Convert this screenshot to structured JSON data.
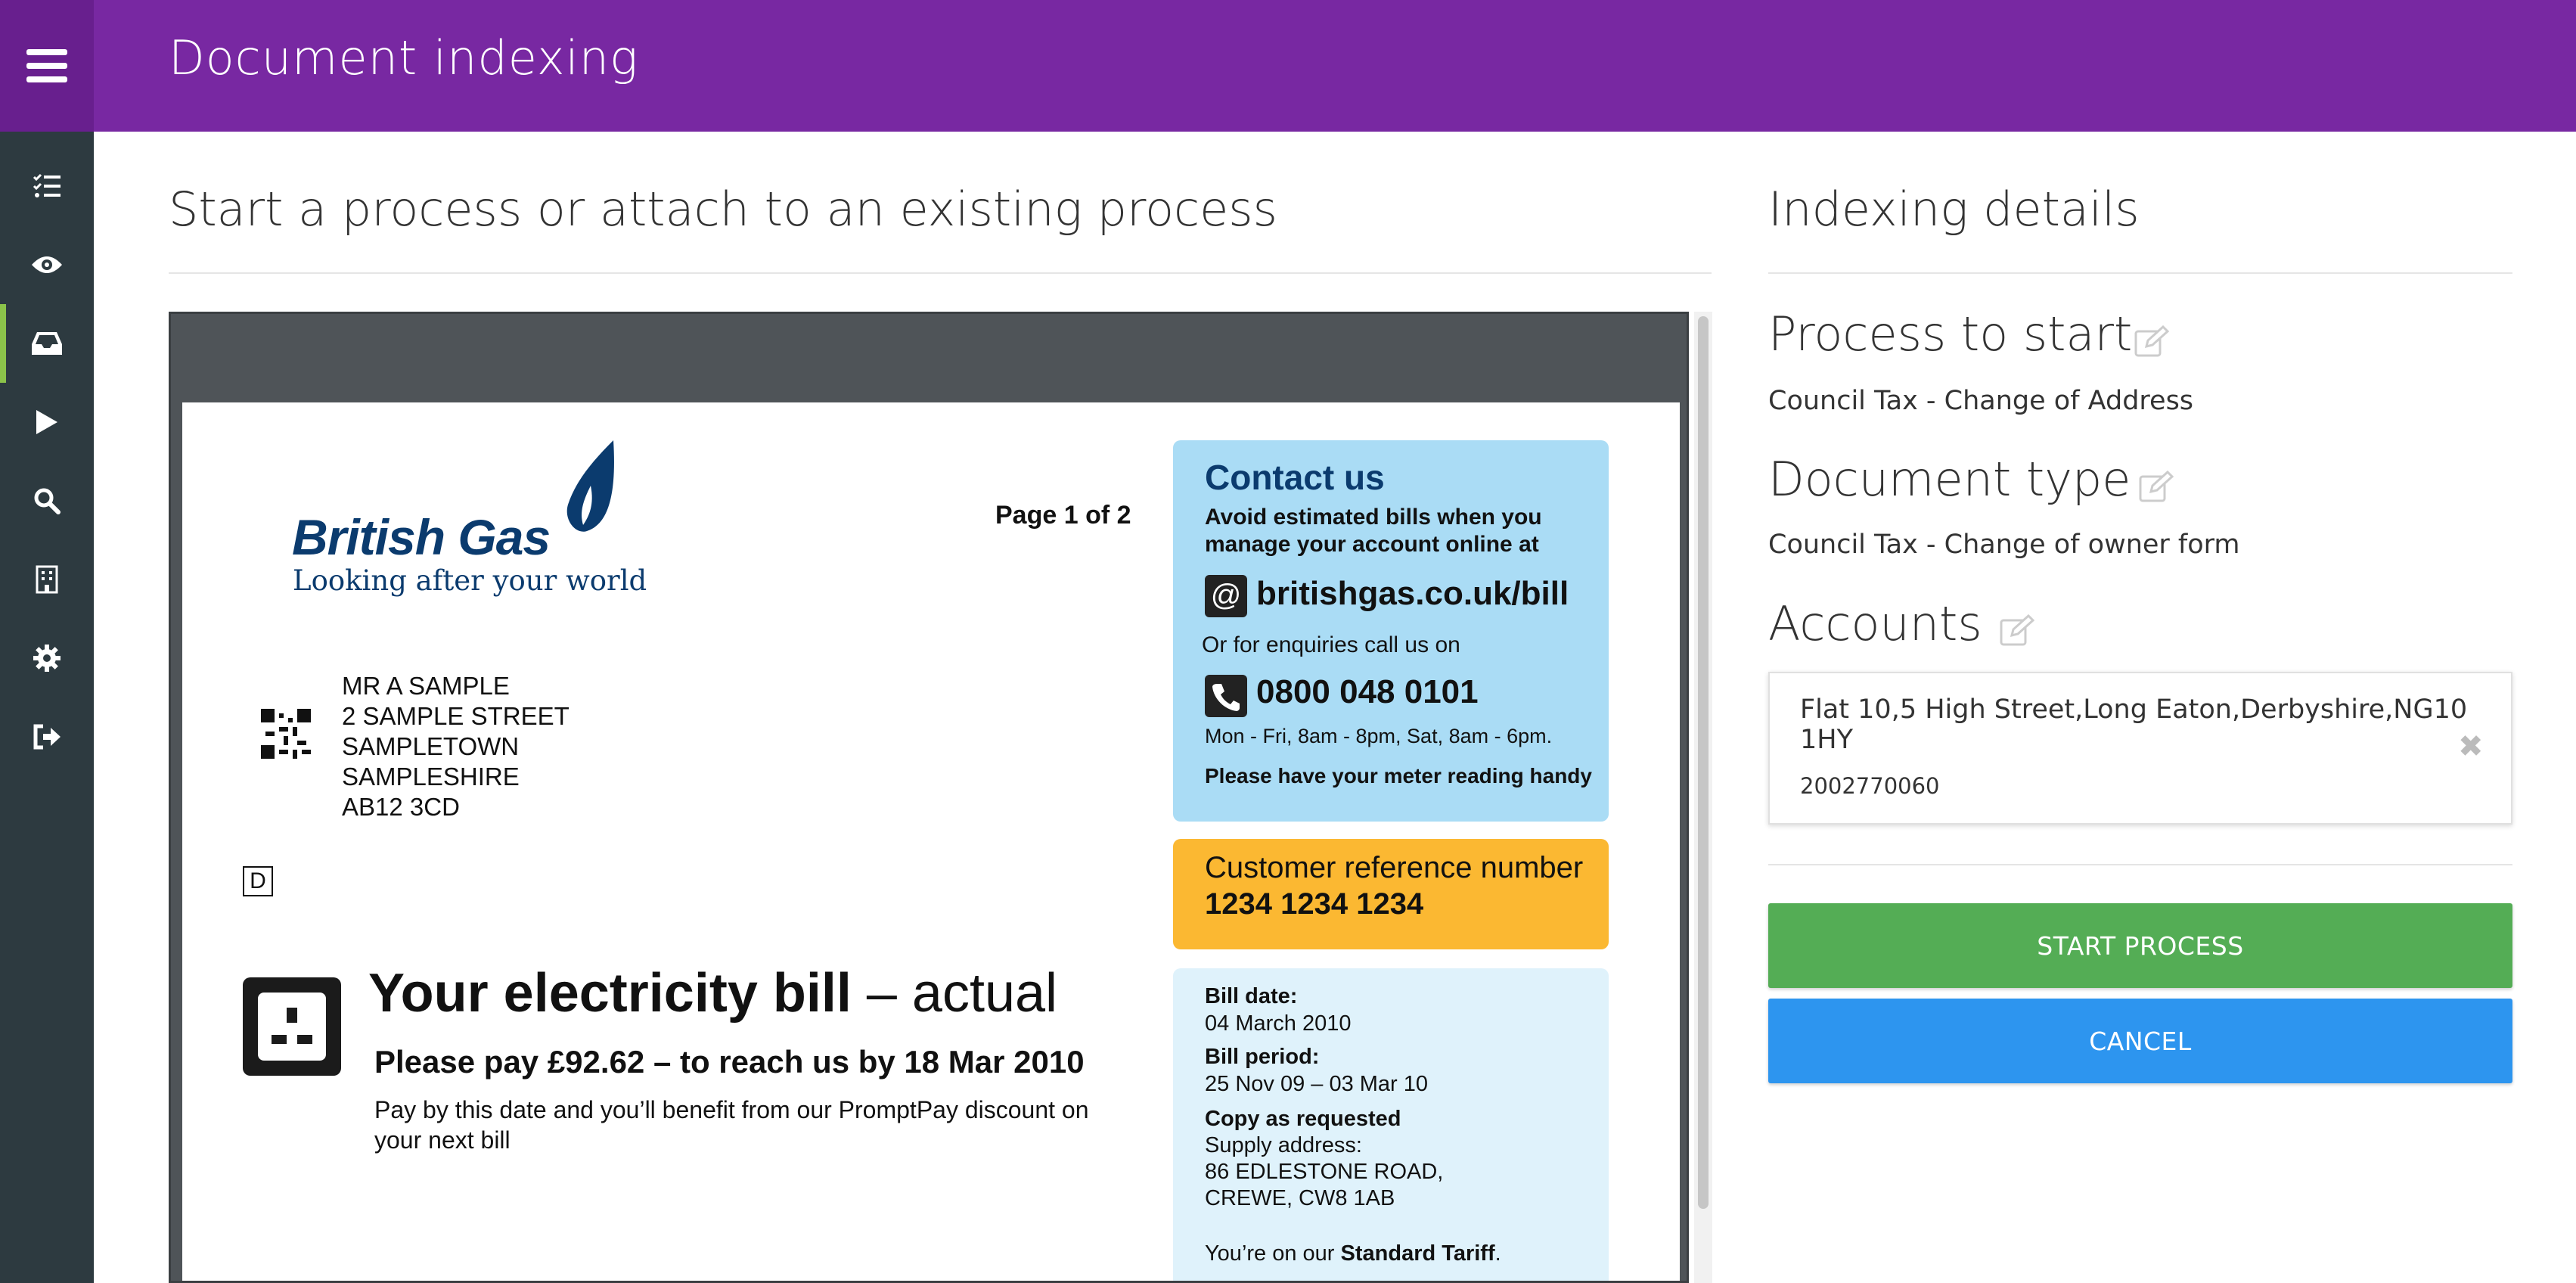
{
  "app": {
    "title": "Document indexing"
  },
  "sidebar": {
    "items": [
      {
        "icon": "task-list-icon"
      },
      {
        "icon": "eye-icon"
      },
      {
        "icon": "inbox-icon",
        "active": true
      },
      {
        "icon": "play-icon"
      },
      {
        "icon": "search-icon"
      },
      {
        "icon": "building-icon"
      },
      {
        "icon": "gear-icon"
      },
      {
        "icon": "sign-out-icon"
      }
    ]
  },
  "main": {
    "heading": "Start a process or attach to an existing process"
  },
  "document": {
    "logo_text": "British Gas",
    "tagline": "Looking after your world",
    "page_count": "Page 1 of 2",
    "address_lines": [
      "MR A SAMPLE",
      "2 SAMPLE STREET",
      "SAMPLETOWN",
      "SAMPLESHIRE",
      "AB12 3CD"
    ],
    "d_mark": "D",
    "title_bold": "Your electricity bill",
    "title_rest": " – actual",
    "pay_line": "Please pay £92.62 – to reach us by 18 Mar 2010",
    "pay_note": "Pay by this date and you’ll benefit from our PromptPay discount on your next bill",
    "contact": {
      "title": "Contact us",
      "line1": "Avoid estimated bills when you manage your account online at",
      "website": "britishgas.co.uk/bill",
      "enquiries": "Or for enquiries call us on",
      "phone": "0800 048 0101",
      "hours": "Mon - Fri, 8am - 8pm, Sat, 8am - 6pm.",
      "meter": "Please have your meter reading handy"
    },
    "reference": {
      "label": "Customer reference number",
      "number": "1234 1234 1234"
    },
    "details": {
      "bill_date_label": "Bill date:",
      "bill_date": "04 March 2010",
      "bill_period_label": "Bill period:",
      "bill_period": "25 Nov 09 – 03 Mar 10",
      "copy_label": "Copy as requested",
      "supply_label": "Supply address:",
      "supply_line1": "86 EDLESTONE ROAD,",
      "supply_line2": "CREWE, CW8 1AB",
      "tariff_prefix": "You’re on our ",
      "tariff_bold": "Standard Tariff",
      "tariff_suffix": "."
    }
  },
  "indexing": {
    "heading": "Indexing details",
    "process": {
      "title": "Process to start",
      "value": "Council Tax - Change of Address"
    },
    "doc_type": {
      "title": "Document type",
      "value": "Council Tax - Change of owner form"
    },
    "accounts": {
      "title": "Accounts",
      "items": [
        {
          "address": "Flat 10,5 High Street,Long Eaton,Derbyshire,NG10 1HY",
          "number": "2002770060"
        }
      ]
    },
    "start_label": "START PROCESS",
    "cancel_label": "CANCEL"
  },
  "colors": {
    "topbar": "#7828a2",
    "sidebar": "#2d3a40",
    "active_indicator": "#8bc34a",
    "start_button": "#54ad55",
    "cancel_button": "#2d95ef"
  }
}
